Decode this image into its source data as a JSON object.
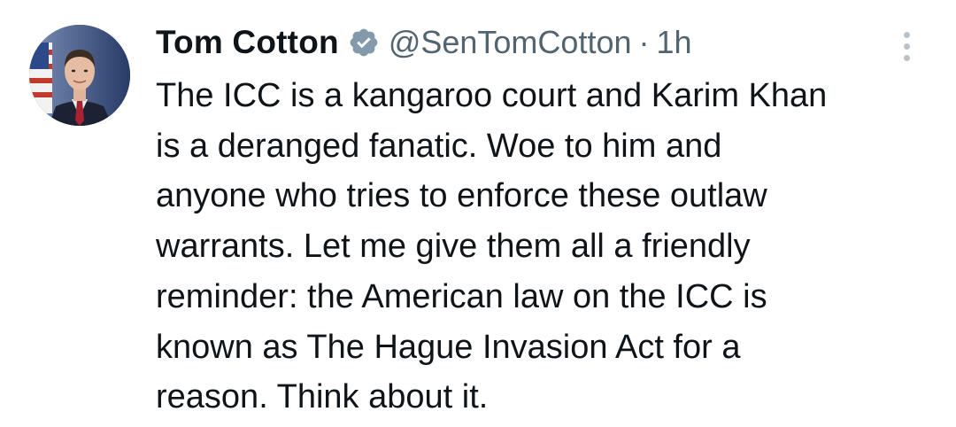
{
  "author": {
    "display_name": "Tom Cotton",
    "handle": "@SenTomCotton",
    "separator": "·",
    "timestamp": "1h",
    "verified_icon": "verified-badge-icon",
    "verified_color": "#829aab"
  },
  "tweet": {
    "lines": [
      "The ICC is a kangaroo court and Karim Khan",
      "is a deranged fanatic. Woe to him and",
      "anyone who tries to enforce these outlaw",
      "warrants. Let me give them all a friendly",
      "reminder: the American law on the ICC is",
      "known as The Hague Invasion Act for a",
      "reason. Think about it."
    ]
  },
  "menu": {
    "icon": "more-options-icon"
  },
  "colors": {
    "text_primary": "#0f1419",
    "text_secondary": "#536471",
    "background": "#ffffff"
  }
}
